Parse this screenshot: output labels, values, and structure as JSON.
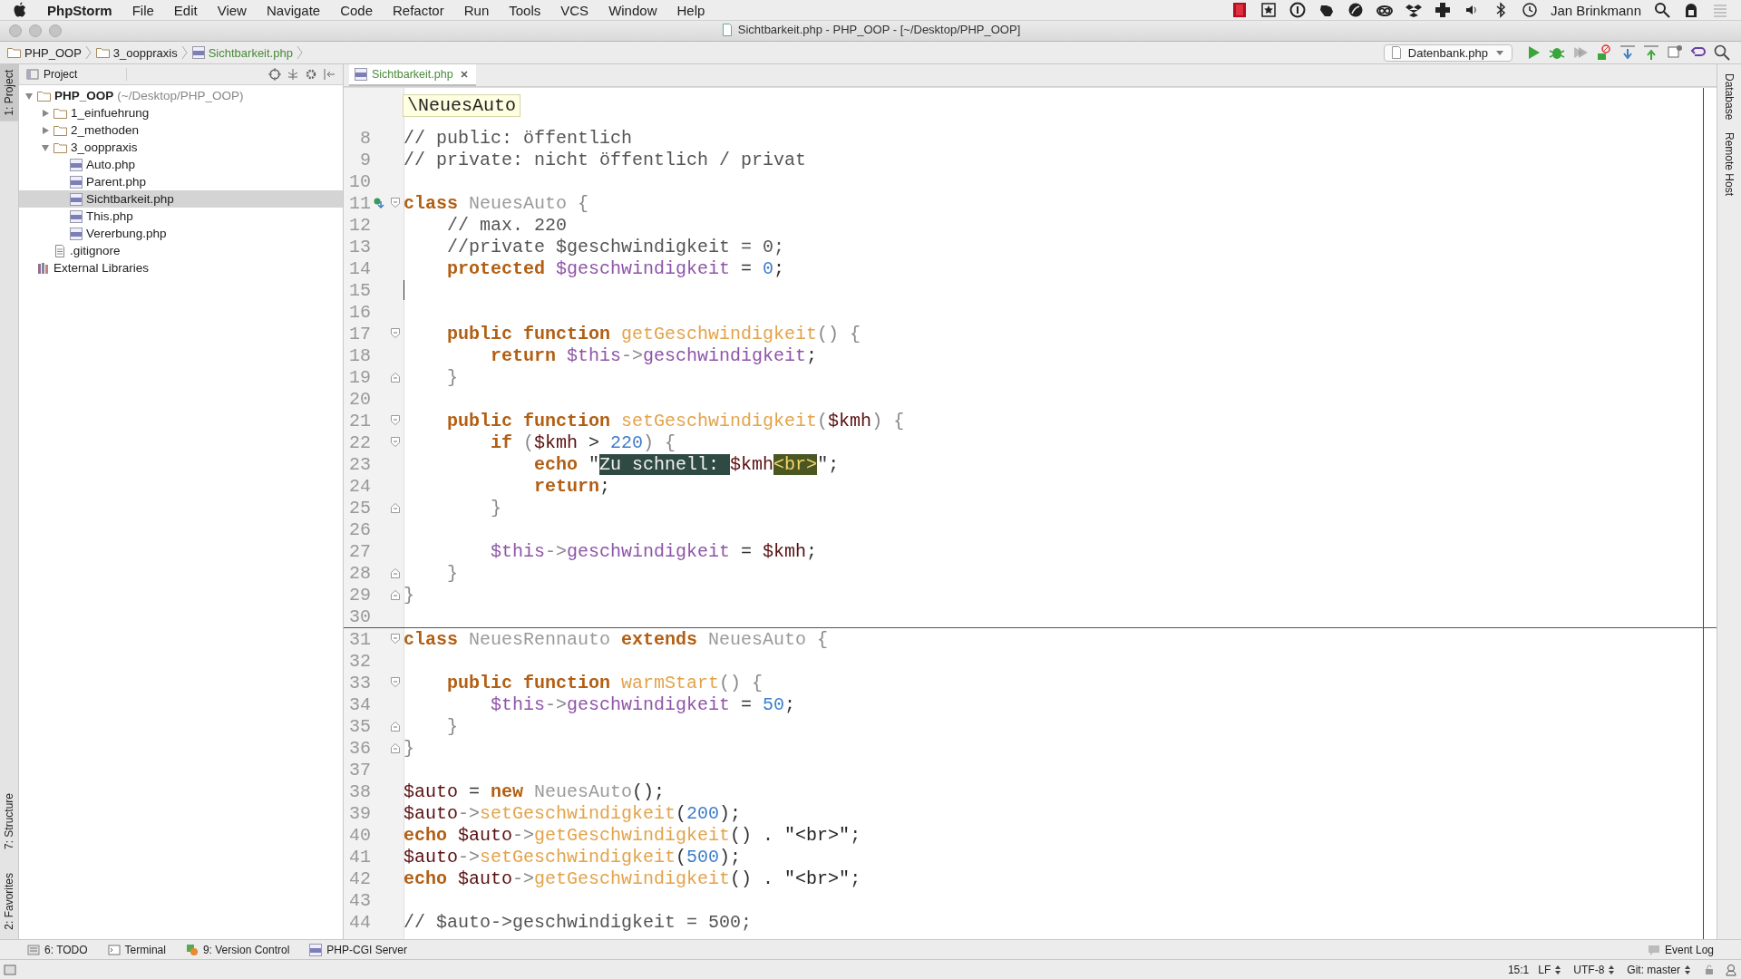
{
  "menu_bar": {
    "app": "PhpStorm",
    "items": [
      "File",
      "Edit",
      "View",
      "Navigate",
      "Code",
      "Refactor",
      "Run",
      "Tools",
      "VCS",
      "Window",
      "Help"
    ],
    "user": "Jan Brinkmann"
  },
  "window": {
    "title": "Sichtbarkeit.php - PHP_OOP - [~/Desktop/PHP_OOP]"
  },
  "breadcrumbs": [
    {
      "label": "PHP_OOP",
      "kind": "folder"
    },
    {
      "label": "3_ooppraxis",
      "kind": "folder"
    },
    {
      "label": "Sichtbarkeit.php",
      "kind": "php"
    }
  ],
  "run_config": "Datenbank.php",
  "left_stripe": {
    "top": [
      {
        "label": "1: Project",
        "selected": true
      }
    ],
    "bottom": [
      {
        "label": "7: Structure",
        "selected": false
      },
      {
        "label": "2: Favorites",
        "selected": false
      }
    ]
  },
  "project_panel": {
    "title": "Project",
    "tree": [
      {
        "label": "PHP_OOP",
        "hint": "(~/Desktop/PHP_OOP)",
        "kind": "root",
        "expanded": true,
        "selected": false,
        "children": [
          {
            "label": "1_einfuehrung",
            "kind": "folder",
            "expanded": false,
            "selected": false
          },
          {
            "label": "2_methoden",
            "kind": "folder",
            "expanded": false,
            "selected": false
          },
          {
            "label": "3_ooppraxis",
            "kind": "folder",
            "expanded": true,
            "selected": false,
            "children": [
              {
                "label": "Auto.php",
                "kind": "php",
                "selected": false
              },
              {
                "label": "Parent.php",
                "kind": "php",
                "selected": false
              },
              {
                "label": "Sichtbarkeit.php",
                "kind": "php",
                "selected": true
              },
              {
                "label": "This.php",
                "kind": "php",
                "selected": false
              },
              {
                "label": "Vererbung.php",
                "kind": "php",
                "selected": false
              }
            ]
          },
          {
            "label": ".gitignore",
            "kind": "text",
            "selected": false
          }
        ]
      },
      {
        "label": "External Libraries",
        "kind": "library",
        "selected": false
      }
    ]
  },
  "editor": {
    "tabs": [
      {
        "label": "Sichtbarkeit.php",
        "selected": true
      }
    ],
    "breadcrumb": "\\NeuesAuto",
    "lines": [
      {
        "number": "8",
        "tokens": [
          {
            "kind": "cm",
            "text": "// public: öffentlich"
          }
        ]
      },
      {
        "number": "9",
        "tokens": [
          {
            "kind": "cm",
            "text": "// private: nicht öffentlich / privat"
          }
        ]
      },
      {
        "number": "10"
      },
      {
        "number": "11",
        "marks": [
          {
            "kind": "override"
          },
          {
            "kind": "fold_start"
          }
        ],
        "tokens": [
          {
            "kind": "kw",
            "text": "class "
          },
          {
            "kind": "cls",
            "text": "NeuesAuto "
          },
          {
            "kind": "br",
            "text": "{"
          }
        ]
      },
      {
        "number": "12",
        "tokens": [
          {
            "kind": "cm",
            "text": "    // max. 220"
          }
        ]
      },
      {
        "number": "13",
        "tokens": [
          {
            "kind": "cm",
            "text": "    //private $geschwindigkeit = 0;"
          }
        ]
      },
      {
        "number": "14",
        "tokens": [
          {
            "kind": "kw",
            "text": "    protected "
          },
          {
            "kind": "var",
            "text": "$geschwindigkeit"
          },
          {
            "kind": "pl",
            "text": " = "
          },
          {
            "kind": "num",
            "text": "0"
          },
          {
            "kind": "pl",
            "text": ";"
          }
        ]
      },
      {
        "number": "15",
        "marks": [
          {
            "kind": "caret"
          }
        ]
      },
      {
        "number": "16"
      },
      {
        "number": "17",
        "marks": [
          {
            "kind": "fold_start"
          }
        ],
        "tokens": [
          {
            "kind": "kw",
            "text": "    public function "
          },
          {
            "kind": "fn",
            "text": "getGeschwindigkeit"
          },
          {
            "kind": "br",
            "text": "() {"
          }
        ]
      },
      {
        "number": "18",
        "tokens": [
          {
            "kind": "kw",
            "text": "        return "
          },
          {
            "kind": "var",
            "text": "$this"
          },
          {
            "kind": "br",
            "text": "->"
          },
          {
            "kind": "var",
            "text": "geschwindigkeit"
          },
          {
            "kind": "pl",
            "text": ";"
          }
        ]
      },
      {
        "number": "19",
        "marks": [
          {
            "kind": "fold_end"
          }
        ],
        "tokens": [
          {
            "kind": "br",
            "text": "    }"
          }
        ]
      },
      {
        "number": "20"
      },
      {
        "number": "21",
        "marks": [
          {
            "kind": "fold_start"
          }
        ],
        "tokens": [
          {
            "kind": "kw",
            "text": "    public function "
          },
          {
            "kind": "fn",
            "text": "setGeschwindigkeit"
          },
          {
            "kind": "br",
            "text": "("
          },
          {
            "kind": "lv",
            "text": "$kmh"
          },
          {
            "kind": "br",
            "text": ") {"
          }
        ]
      },
      {
        "number": "22",
        "marks": [
          {
            "kind": "fold_start"
          }
        ],
        "tokens": [
          {
            "kind": "kw",
            "text": "        if "
          },
          {
            "kind": "br",
            "text": "("
          },
          {
            "kind": "lv",
            "text": "$kmh"
          },
          {
            "kind": "pl",
            "text": " > "
          },
          {
            "kind": "num",
            "text": "220"
          },
          {
            "kind": "br",
            "text": ") {"
          }
        ]
      },
      {
        "number": "23",
        "tokens": [
          {
            "kind": "kw",
            "text": "            echo "
          },
          {
            "kind": "pl",
            "text": "\""
          },
          {
            "kind": "hl",
            "text": "Zu schnell: "
          },
          {
            "kind": "lv",
            "text": "$kmh"
          },
          {
            "kind": "hl2",
            "text": "<br>"
          },
          {
            "kind": "pl",
            "text": "\";"
          }
        ]
      },
      {
        "number": "24",
        "tokens": [
          {
            "kind": "kw",
            "text": "            return"
          },
          {
            "kind": "pl",
            "text": ";"
          }
        ]
      },
      {
        "number": "25",
        "marks": [
          {
            "kind": "fold_end"
          }
        ],
        "tokens": [
          {
            "kind": "br",
            "text": "        }"
          }
        ]
      },
      {
        "number": "26"
      },
      {
        "number": "27",
        "tokens": [
          {
            "kind": "var",
            "text": "        $this"
          },
          {
            "kind": "br",
            "text": "->"
          },
          {
            "kind": "var",
            "text": "geschwindigkeit"
          },
          {
            "kind": "pl",
            "text": " = "
          },
          {
            "kind": "lv",
            "text": "$kmh"
          },
          {
            "kind": "pl",
            "text": ";"
          }
        ]
      },
      {
        "number": "28",
        "marks": [
          {
            "kind": "fold_end"
          }
        ],
        "tokens": [
          {
            "kind": "br",
            "text": "    }"
          }
        ]
      },
      {
        "number": "29",
        "marks": [
          {
            "kind": "fold_end"
          }
        ],
        "tokens": [
          {
            "kind": "br",
            "text": "}"
          }
        ]
      },
      {
        "number": "30"
      },
      {
        "number": "31",
        "marks": [
          {
            "kind": "fold_start"
          }
        ],
        "separator": true,
        "tokens": [
          {
            "kind": "kw",
            "text": "class "
          },
          {
            "kind": "cls",
            "text": "NeuesRennauto "
          },
          {
            "kind": "kw",
            "text": "extends "
          },
          {
            "kind": "cls",
            "text": "NeuesAuto "
          },
          {
            "kind": "br",
            "text": "{"
          }
        ]
      },
      {
        "number": "32"
      },
      {
        "number": "33",
        "marks": [
          {
            "kind": "fold_start"
          }
        ],
        "tokens": [
          {
            "kind": "kw",
            "text": "    public function "
          },
          {
            "kind": "fn",
            "text": "warmStart"
          },
          {
            "kind": "br",
            "text": "() {"
          }
        ]
      },
      {
        "number": "34",
        "tokens": [
          {
            "kind": "var",
            "text": "        $this"
          },
          {
            "kind": "br",
            "text": "->"
          },
          {
            "kind": "var",
            "text": "geschwindigkeit"
          },
          {
            "kind": "pl",
            "text": " = "
          },
          {
            "kind": "num",
            "text": "50"
          },
          {
            "kind": "pl",
            "text": ";"
          }
        ]
      },
      {
        "number": "35",
        "marks": [
          {
            "kind": "fold_end"
          }
        ],
        "tokens": [
          {
            "kind": "br",
            "text": "    }"
          }
        ]
      },
      {
        "number": "36",
        "marks": [
          {
            "kind": "fold_end"
          }
        ],
        "tokens": [
          {
            "kind": "br",
            "text": "}"
          }
        ]
      },
      {
        "number": "37"
      },
      {
        "number": "38",
        "tokens": [
          {
            "kind": "lv",
            "text": "$auto"
          },
          {
            "kind": "pl",
            "text": " = "
          },
          {
            "kind": "kw",
            "text": "new "
          },
          {
            "kind": "cls",
            "text": "NeuesAuto"
          },
          {
            "kind": "pl",
            "text": "();"
          }
        ]
      },
      {
        "number": "39",
        "tokens": [
          {
            "kind": "lv",
            "text": "$auto"
          },
          {
            "kind": "br",
            "text": "->"
          },
          {
            "kind": "fn",
            "text": "setGeschwindigkeit"
          },
          {
            "kind": "pl",
            "text": "("
          },
          {
            "kind": "num",
            "text": "200"
          },
          {
            "kind": "pl",
            "text": ");"
          }
        ]
      },
      {
        "number": "40",
        "tokens": [
          {
            "kind": "kw",
            "text": "echo "
          },
          {
            "kind": "lv",
            "text": "$auto"
          },
          {
            "kind": "br",
            "text": "->"
          },
          {
            "kind": "fn",
            "text": "getGeschwindigkeit"
          },
          {
            "kind": "pl",
            "text": "() . "
          },
          {
            "kind": "str",
            "text": "\"<br>\""
          },
          {
            "kind": "pl",
            "text": ";"
          }
        ]
      },
      {
        "number": "41",
        "tokens": [
          {
            "kind": "lv",
            "text": "$auto"
          },
          {
            "kind": "br",
            "text": "->"
          },
          {
            "kind": "fn",
            "text": "setGeschwindigkeit"
          },
          {
            "kind": "pl",
            "text": "("
          },
          {
            "kind": "num",
            "text": "500"
          },
          {
            "kind": "pl",
            "text": ");"
          }
        ]
      },
      {
        "number": "42",
        "tokens": [
          {
            "kind": "kw",
            "text": "echo "
          },
          {
            "kind": "lv",
            "text": "$auto"
          },
          {
            "kind": "br",
            "text": "->"
          },
          {
            "kind": "fn",
            "text": "getGeschwindigkeit"
          },
          {
            "kind": "pl",
            "text": "() . "
          },
          {
            "kind": "str",
            "text": "\"<br>\""
          },
          {
            "kind": "pl",
            "text": ";"
          }
        ]
      },
      {
        "number": "43"
      },
      {
        "number": "44",
        "tokens": [
          {
            "kind": "cm",
            "text": "// $auto->geschwindigkeit = 500;"
          }
        ]
      }
    ]
  },
  "right_stripe": [
    "Database",
    "Remote Host"
  ],
  "tool_windows": [
    {
      "label": "6: TODO",
      "kind": "todo"
    },
    {
      "label": "Terminal",
      "kind": "terminal"
    },
    {
      "label": "9: Version Control",
      "kind": "vcs"
    },
    {
      "label": "PHP-CGI Server",
      "kind": "php"
    }
  ],
  "event_log": "Event Log",
  "status_bar": [
    {
      "text": "15:1",
      "switch": false
    },
    {
      "text": "LF",
      "switch": true
    },
    {
      "text": "UTF-8",
      "switch": true
    },
    {
      "text": "Git: master",
      "switch": true
    }
  ]
}
